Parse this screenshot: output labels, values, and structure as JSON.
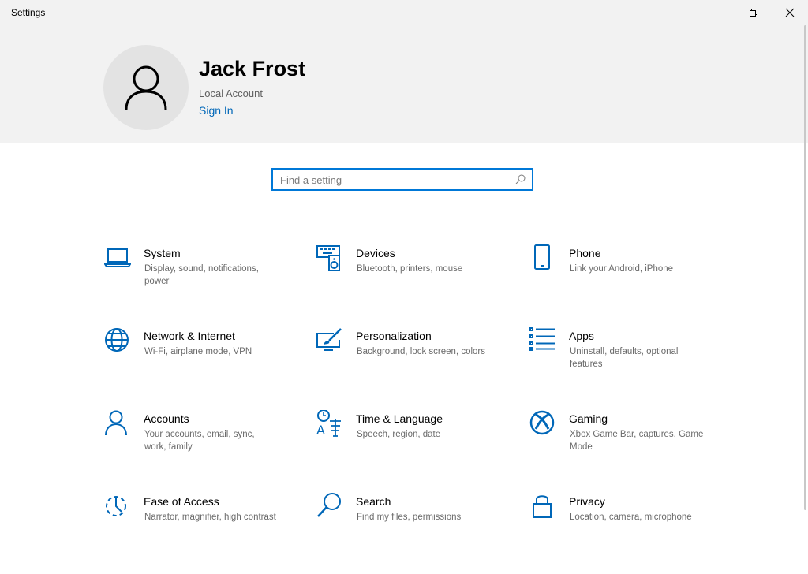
{
  "window": {
    "title": "Settings",
    "controls": {
      "minimize": "minimize-icon",
      "maximize": "restore-icon",
      "close": "close-icon"
    }
  },
  "profile": {
    "name": "Jack Frost",
    "account_type": "Local Account",
    "sign_in_label": "Sign In"
  },
  "search": {
    "placeholder": "Find a setting",
    "value": ""
  },
  "colors": {
    "accent": "#0078d7",
    "icon": "#0067b8",
    "header_bg": "#f2f2f2",
    "desc_text": "#6a6a6a"
  },
  "categories": [
    {
      "name": "System",
      "description": "Display, sound, notifications, power",
      "icon": "laptop-icon"
    },
    {
      "name": "Devices",
      "description": "Bluetooth, printers, mouse",
      "icon": "keyboard-speaker-icon"
    },
    {
      "name": "Phone",
      "description": "Link your Android, iPhone",
      "icon": "phone-icon"
    },
    {
      "name": "Network & Internet",
      "description": "Wi-Fi, airplane mode, VPN",
      "icon": "globe-icon"
    },
    {
      "name": "Personalization",
      "description": "Background, lock screen, colors",
      "icon": "paint-brush-icon"
    },
    {
      "name": "Apps",
      "description": "Uninstall, defaults, optional features",
      "icon": "list-icon"
    },
    {
      "name": "Accounts",
      "description": "Your accounts, email, sync, work, family",
      "icon": "person-icon"
    },
    {
      "name": "Time & Language",
      "description": "Speech, region, date",
      "icon": "time-language-icon"
    },
    {
      "name": "Gaming",
      "description": "Xbox Game Bar, captures, Game Mode",
      "icon": "xbox-icon"
    },
    {
      "name": "Ease of Access",
      "description": "Narrator, magnifier, high contrast",
      "icon": "ease-of-access-icon"
    },
    {
      "name": "Search",
      "description": "Find my files, permissions",
      "icon": "magnifier-icon"
    },
    {
      "name": "Privacy",
      "description": "Location, camera, microphone",
      "icon": "lock-icon"
    }
  ]
}
